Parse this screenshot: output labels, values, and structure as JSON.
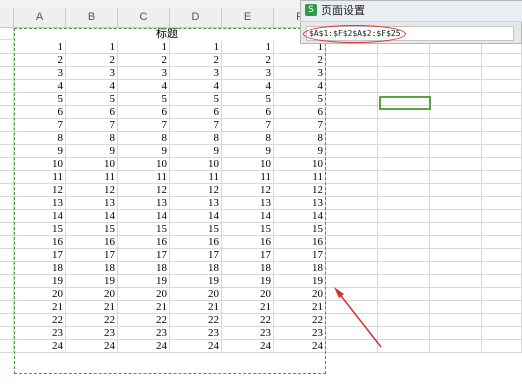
{
  "window": {
    "title": "页面设置"
  },
  "columns": [
    "A",
    "B",
    "C",
    "D",
    "E",
    "F"
  ],
  "sheet": {
    "title": "标题",
    "rows": [
      [
        1,
        1,
        1,
        1,
        1,
        1
      ],
      [
        2,
        2,
        2,
        2,
        2,
        2
      ],
      [
        3,
        3,
        3,
        3,
        3,
        3
      ],
      [
        4,
        4,
        4,
        4,
        4,
        4
      ],
      [
        5,
        5,
        5,
        5,
        5,
        5
      ],
      [
        6,
        6,
        6,
        6,
        6,
        6
      ],
      [
        7,
        7,
        7,
        7,
        7,
        7
      ],
      [
        8,
        8,
        8,
        8,
        8,
        8
      ],
      [
        9,
        9,
        9,
        9,
        9,
        9
      ],
      [
        10,
        10,
        10,
        10,
        10,
        10
      ],
      [
        11,
        11,
        11,
        11,
        11,
        11
      ],
      [
        12,
        12,
        12,
        12,
        12,
        12
      ],
      [
        13,
        13,
        13,
        13,
        13,
        13
      ],
      [
        14,
        14,
        14,
        14,
        14,
        14
      ],
      [
        15,
        15,
        15,
        15,
        15,
        15
      ],
      [
        16,
        16,
        16,
        16,
        16,
        16
      ],
      [
        17,
        17,
        17,
        17,
        17,
        17
      ],
      [
        18,
        18,
        18,
        18,
        18,
        18
      ],
      [
        19,
        19,
        19,
        19,
        19,
        19
      ],
      [
        20,
        20,
        20,
        20,
        20,
        20
      ],
      [
        21,
        21,
        21,
        21,
        21,
        21
      ],
      [
        22,
        22,
        22,
        22,
        22,
        22
      ],
      [
        23,
        23,
        23,
        23,
        23,
        23
      ],
      [
        24,
        24,
        24,
        24,
        24,
        24
      ]
    ]
  },
  "dialog": {
    "icon": "wps-s-icon",
    "icon_glyph": "S",
    "range_value": "$A$1:$F$2$A$2:$F$25"
  },
  "colors": {
    "print_area_border": "#4a9a3a",
    "annotation": "#d33333",
    "dialog_icon": "#2f9b47"
  }
}
